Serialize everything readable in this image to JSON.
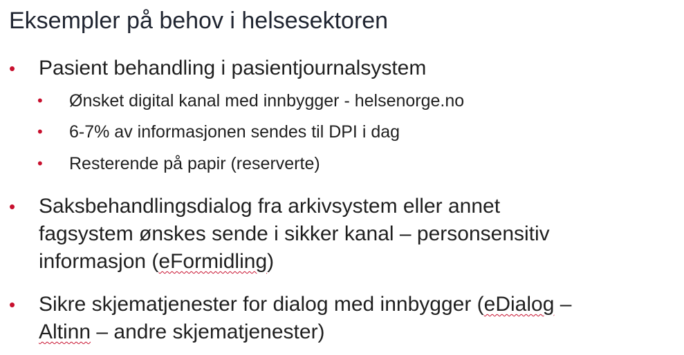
{
  "slide": {
    "title": "Eksempler på behov i helsesektoren",
    "bullet_glyph": "•",
    "accent_color": "#c8102e",
    "items": [
      {
        "text": "Pasient behandling i pasientjournalsystem",
        "subitems": [
          "Ønsket digital kanal med innbygger - helsenorge.no",
          "6-7% av informasjonen sendes til DPI i dag",
          "Resterende på papir (reserverte)"
        ]
      },
      {
        "lines": [
          "Saksbehandlingsdialog fra arkivsystem eller annet",
          "fagsystem ønskes sende i sikker kanal – personsensitiv",
          "informasjon (",
          "eFormidling",
          ")"
        ]
      },
      {
        "lines": [
          "Sikre skjematjenester for dialog med innbygger (",
          "eDialog",
          " –",
          "Altinn",
          " – andre skjematjenester)"
        ]
      }
    ]
  }
}
